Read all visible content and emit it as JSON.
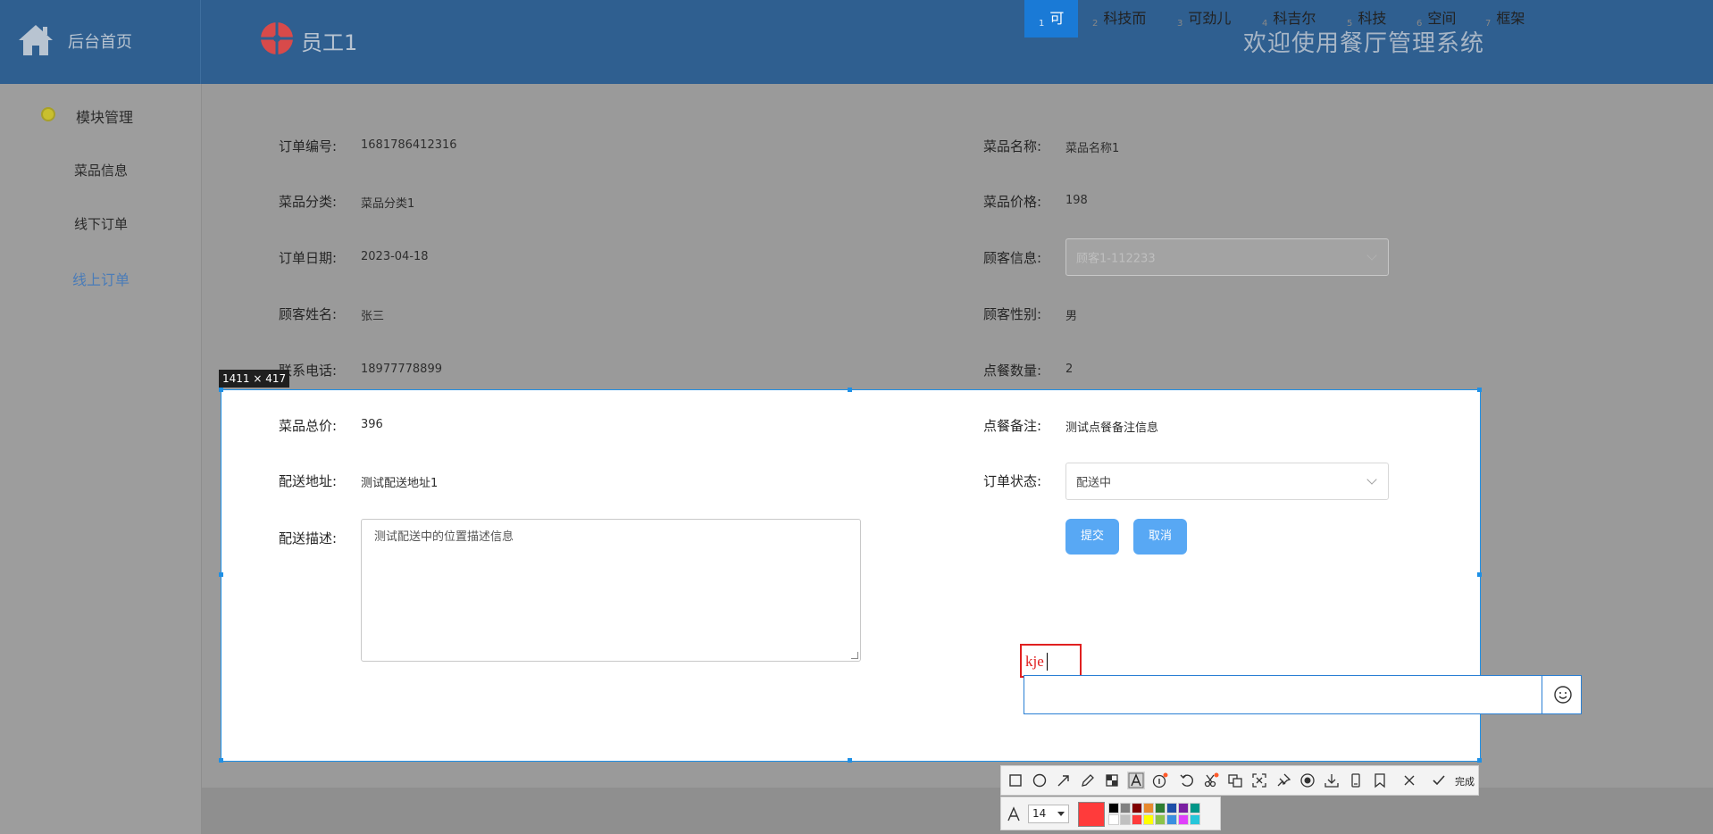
{
  "header": {
    "brand_label": "后台首页",
    "user_name": "员工1",
    "welcome": "欢迎使用餐厅管理系统"
  },
  "sidebar": {
    "group_label": "模块管理",
    "items": [
      {
        "label": "菜品信息",
        "active": false
      },
      {
        "label": "线下订单",
        "active": false
      },
      {
        "label": "线上订单",
        "active": true
      }
    ]
  },
  "form": {
    "order_no_label": "订单编号:",
    "order_no": "1681786412316",
    "dish_name_label": "菜品名称:",
    "dish_name": "菜品名称1",
    "dish_category_label": "菜品分类:",
    "dish_category": "菜品分类1",
    "dish_price_label": "菜品价格:",
    "dish_price": "198",
    "order_date_label": "订单日期:",
    "order_date": "2023-04-18",
    "customer_info_label": "顾客信息:",
    "customer_info": "顾客1-112233",
    "customer_name_label": "顾客姓名:",
    "customer_name": "张三",
    "customer_gender_label": "顾客性别:",
    "customer_gender": "男",
    "phone_label": "联系电话:",
    "phone": "18977778899",
    "quantity_label": "点餐数量:",
    "quantity": "2",
    "total_label": "菜品总价:",
    "total": "396",
    "remark_label": "点餐备注:",
    "remark": "测试点餐备注信息",
    "address_label": "配送地址:",
    "address": "测试配送地址1",
    "status_label": "订单状态:",
    "status": "配送中",
    "desc_label": "配送描述:",
    "desc": "测试配送中的位置描述信息",
    "submit_label": "提交",
    "cancel_label": "取消"
  },
  "capture": {
    "size_label": "1411 × 417",
    "typed_text": "kje",
    "ime_candidates": [
      {
        "n": "1",
        "text": "可"
      },
      {
        "n": "2",
        "text": "科技而"
      },
      {
        "n": "3",
        "text": "可劲儿"
      },
      {
        "n": "4",
        "text": "科吉尔"
      },
      {
        "n": "5",
        "text": "科技"
      },
      {
        "n": "6",
        "text": "空间"
      },
      {
        "n": "7",
        "text": "框架"
      }
    ],
    "done_label": "完成",
    "font_size": "14",
    "current_color": "#ff3b3b",
    "palette": [
      "#000000",
      "#808080",
      "#800000",
      "#e88a2e",
      "#2e7d32",
      "#1e4fa8",
      "#7a1fa2",
      "#009688",
      "#ffffff",
      "#c0c0c0",
      "#ff3b3b",
      "#ffff00",
      "#8bc34a",
      "#3a8fe0",
      "#e040fb",
      "#26c6da"
    ]
  },
  "colors": {
    "header_bg": "#2f5f90",
    "selection_border": "#1e90e6",
    "button": "#58a8f4",
    "active_menu": "#4a7cb8"
  }
}
